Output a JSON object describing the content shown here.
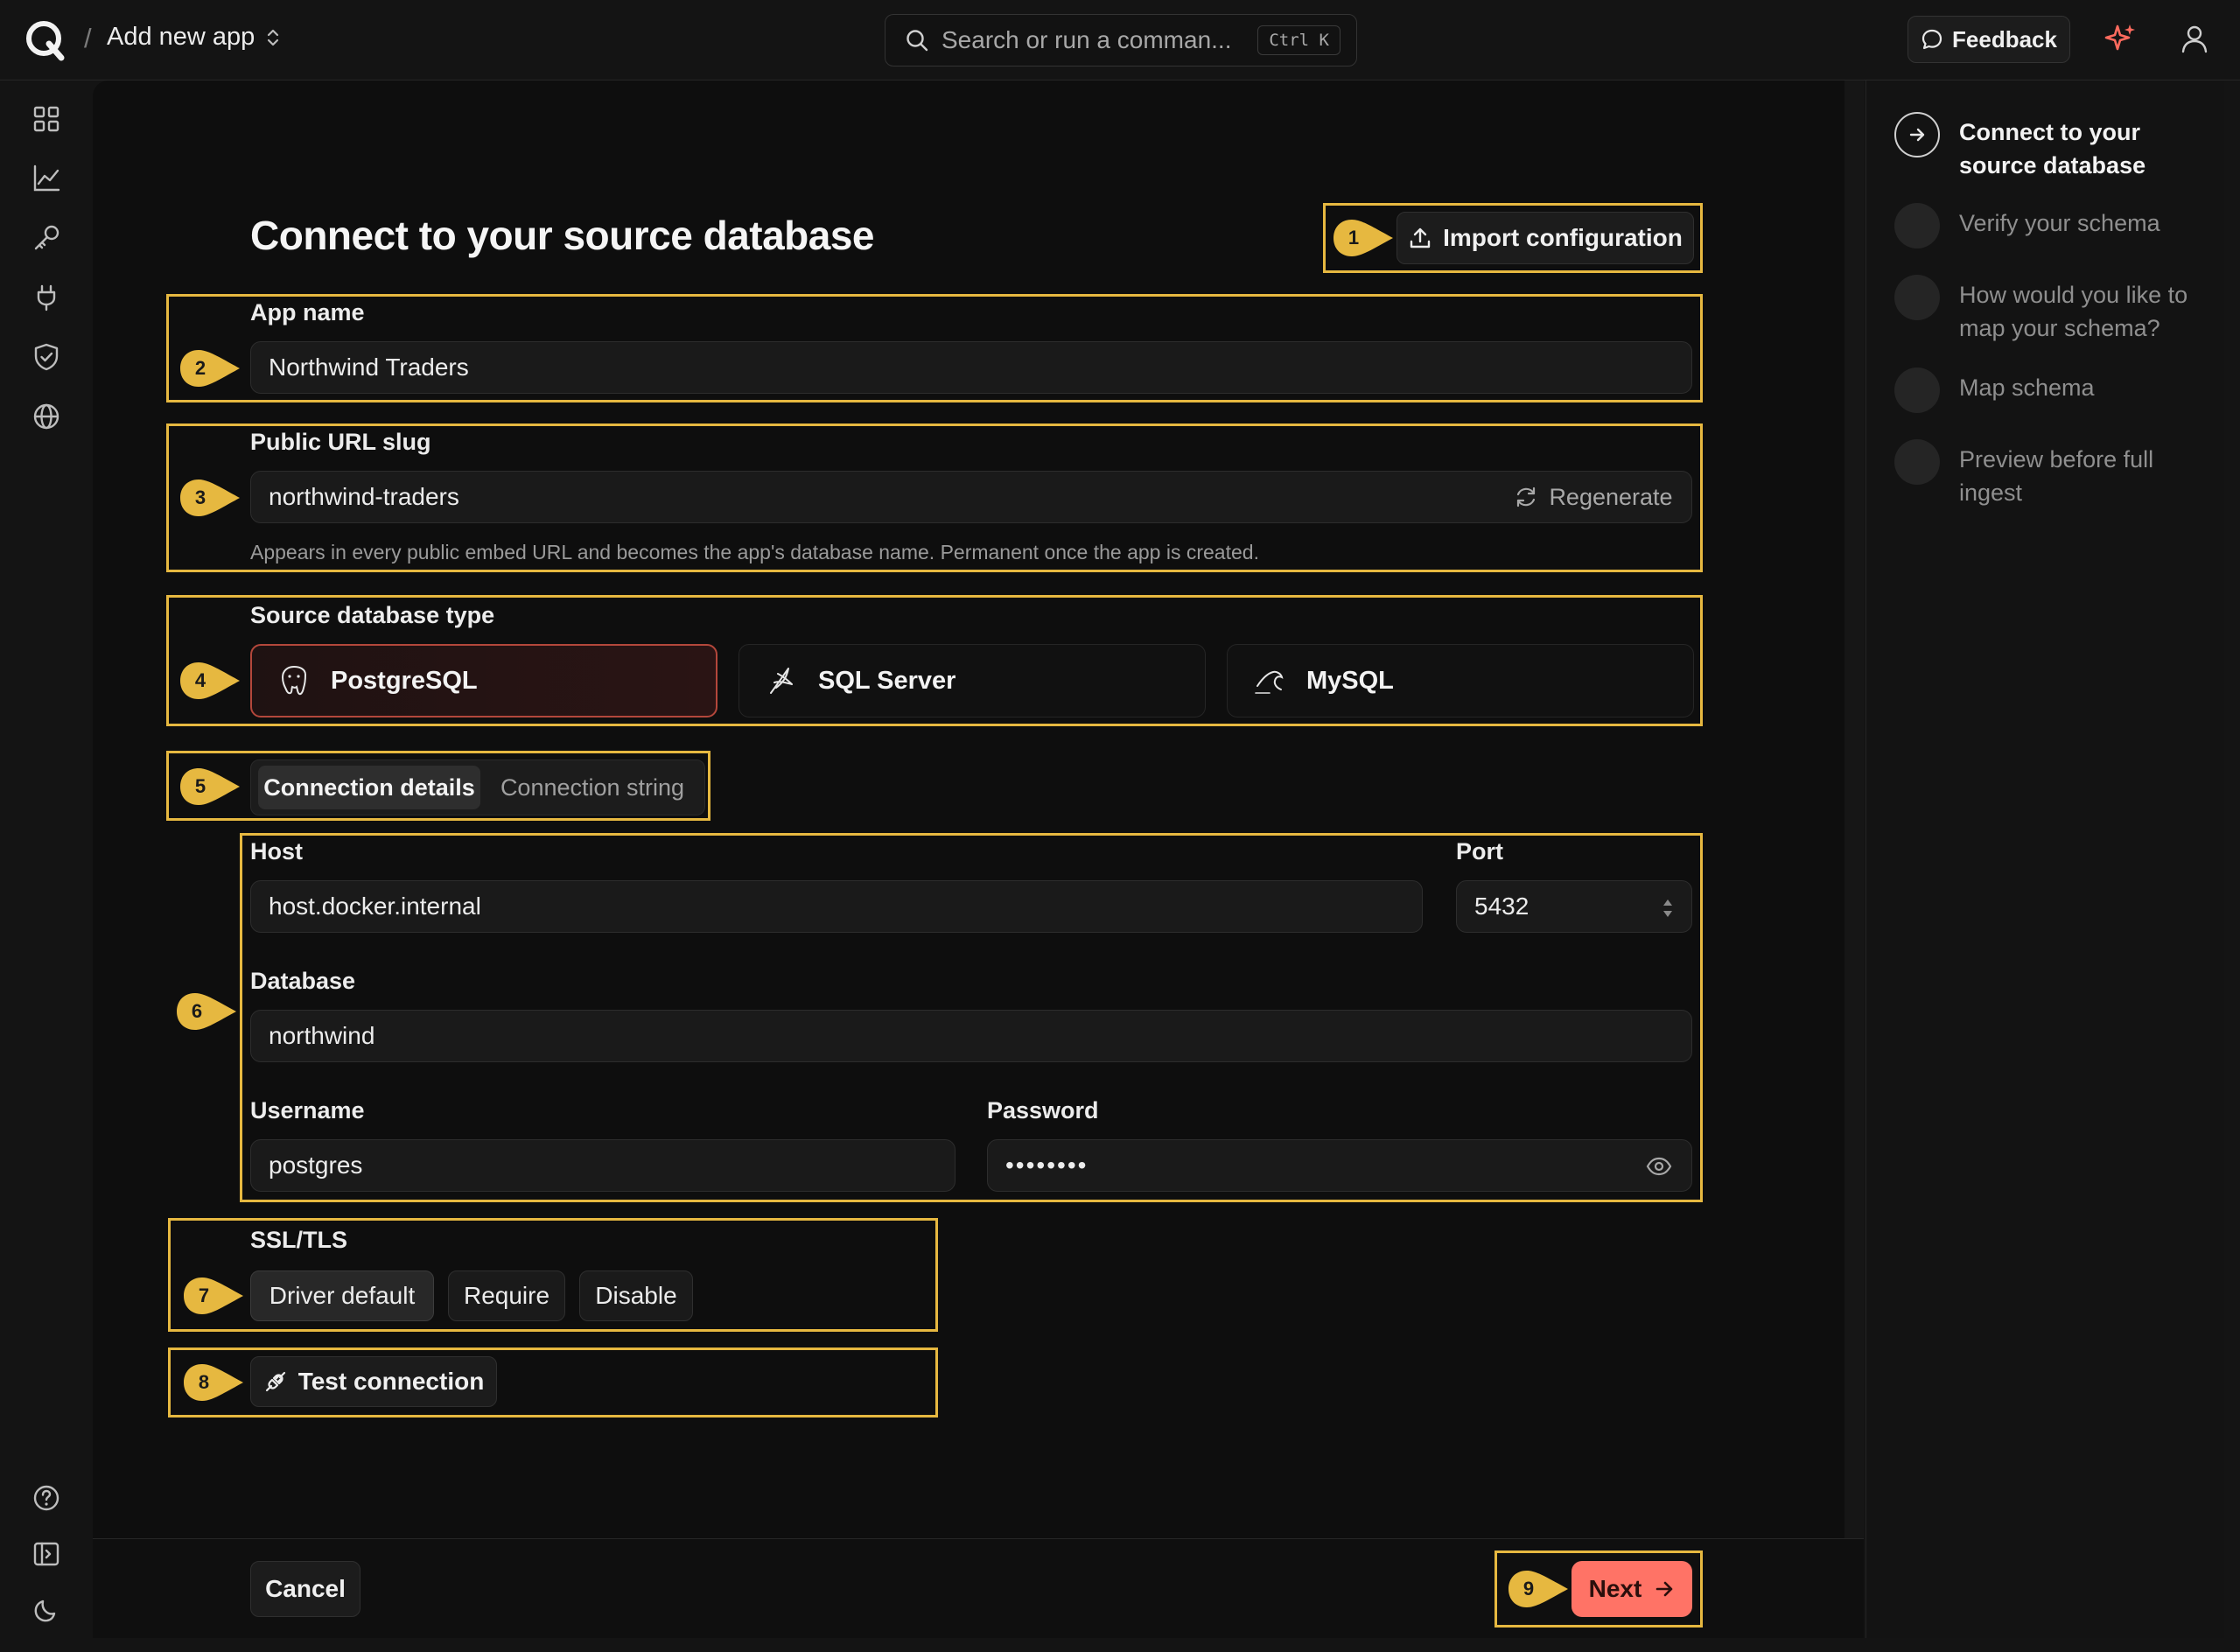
{
  "topbar": {
    "breadcrumb_sep": "/",
    "breadcrumb": "Add new app",
    "search_placeholder": "Search or run a comman...",
    "search_shortcut": "Ctrl K",
    "feedback_label": "Feedback"
  },
  "page": {
    "title": "Connect to your source database",
    "import_label": "Import configuration"
  },
  "form": {
    "app_name": {
      "label": "App name",
      "value": "Northwind Traders"
    },
    "slug": {
      "label": "Public URL slug",
      "value": "northwind-traders",
      "regenerate_label": "Regenerate",
      "hint": "Appears in every public embed URL and becomes the app's database name. Permanent once the app is created."
    },
    "db_type": {
      "label": "Source database type",
      "options": [
        "PostgreSQL",
        "SQL Server",
        "MySQL"
      ],
      "selected": "PostgreSQL"
    },
    "mode_tabs": [
      "Connection details",
      "Connection string"
    ],
    "mode_selected": "Connection details",
    "host": {
      "label": "Host",
      "value": "host.docker.internal"
    },
    "port": {
      "label": "Port",
      "value": "5432"
    },
    "database": {
      "label": "Database",
      "value": "northwind"
    },
    "username": {
      "label": "Username",
      "value": "postgres"
    },
    "password": {
      "label": "Password",
      "value": "••••••••"
    },
    "ssl": {
      "label": "SSL/TLS",
      "options": [
        "Driver default",
        "Require",
        "Disable"
      ],
      "selected": "Driver default"
    },
    "test_label": "Test connection"
  },
  "footer": {
    "cancel_label": "Cancel",
    "next_label": "Next"
  },
  "annotations": [
    "1",
    "2",
    "3",
    "4",
    "5",
    "6",
    "7",
    "8",
    "9"
  ],
  "steps": [
    {
      "label": "Connect to your source database",
      "current": true
    },
    {
      "label": "Verify your schema",
      "current": false
    },
    {
      "label": "How would you like to map your schema?",
      "current": false
    },
    {
      "label": "Map schema",
      "current": false
    },
    {
      "label": "Preview before full ingest",
      "current": false
    }
  ],
  "colors": {
    "accent": "#ff7366",
    "annotation": "#e6b840",
    "selected_border": "#b3473b"
  },
  "icons": [
    "logo-icon",
    "chevron-updown-icon",
    "search-icon",
    "chat-bubble-icon",
    "sparkle-icon",
    "user-icon",
    "grid-icon",
    "chart-line-icon",
    "key-icon",
    "plug-icon",
    "shield-check-icon",
    "globe-icon",
    "help-circle-icon",
    "panel-toggle-icon",
    "moon-icon",
    "upload-icon",
    "refresh-icon",
    "postgresql-icon",
    "sql-server-icon",
    "mysql-icon",
    "stepper-icon",
    "eye-icon",
    "plug-connect-icon",
    "arrow-right-icon"
  ]
}
